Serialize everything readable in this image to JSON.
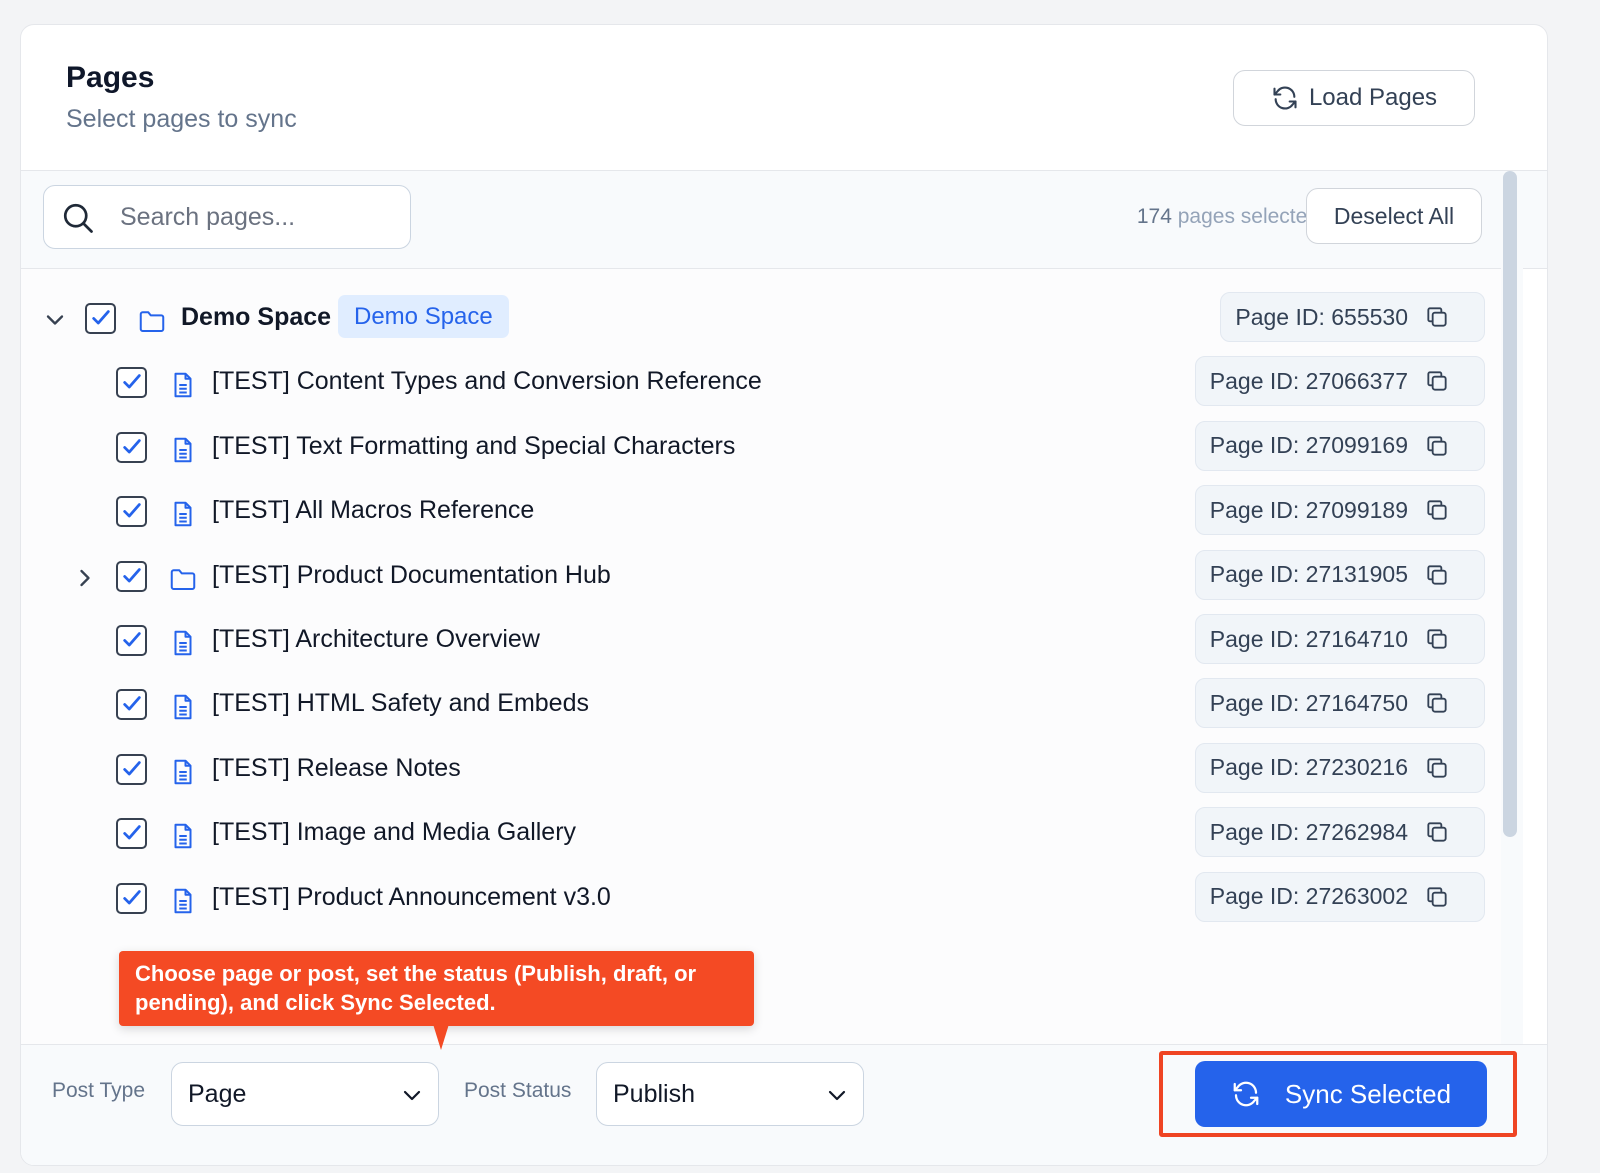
{
  "header": {
    "title": "Pages",
    "subtitle": "Select pages to sync",
    "load_button": "Load Pages"
  },
  "toolbar": {
    "search_placeholder": "Search pages...",
    "selected_count": "174",
    "selected_suffix": " pages selected",
    "deselect_button": "Deselect All"
  },
  "tree": {
    "space": {
      "label": "Demo Space",
      "badge": "Demo Space",
      "page_id": "Page ID: 655530",
      "checked": true,
      "expanded": true
    },
    "pages": [
      {
        "label": "[TEST] Content Types and Conversion Reference",
        "page_id": "Page ID: 27066377",
        "type": "page",
        "checked": true
      },
      {
        "label": "[TEST] Text Formatting and Special Characters",
        "page_id": "Page ID: 27099169",
        "type": "page",
        "checked": true
      },
      {
        "label": "[TEST] All Macros Reference",
        "page_id": "Page ID: 27099189",
        "type": "page",
        "checked": true
      },
      {
        "label": "[TEST] Product Documentation Hub",
        "page_id": "Page ID: 27131905",
        "type": "folder",
        "checked": true,
        "expandable": true
      },
      {
        "label": "[TEST] Architecture Overview",
        "page_id": "Page ID: 27164710",
        "type": "page",
        "checked": true
      },
      {
        "label": "[TEST] HTML Safety and Embeds",
        "page_id": "Page ID: 27164750",
        "type": "page",
        "checked": true
      },
      {
        "label": "[TEST] Release Notes",
        "page_id": "Page ID: 27230216",
        "type": "page",
        "checked": true
      },
      {
        "label": "[TEST] Image and Media Gallery",
        "page_id": "Page ID: 27262984",
        "type": "page",
        "checked": true
      },
      {
        "label": "[TEST] Product Announcement v3.0",
        "page_id": "Page ID: 27263002",
        "type": "page",
        "checked": true
      }
    ]
  },
  "tooltip": {
    "text": "Choose page or post, set the status (Publish, draft, or pending), and click Sync Selected."
  },
  "footer": {
    "post_type_label": "Post Type",
    "post_type_value": "Page",
    "post_status_label": "Post Status",
    "post_status_value": "Publish",
    "sync_button": "Sync Selected"
  },
  "colors": {
    "accent": "#2563eb",
    "badge_bg": "#e0edff",
    "highlight": "#ef4423",
    "tooltip_bg": "#f44a24"
  },
  "icons": {
    "load": "refresh-icon",
    "search": "search-icon",
    "copy": "copy-icon",
    "folder": "folder-icon",
    "page": "document-icon",
    "sync": "refresh-icon",
    "select": "chevron-down-icon"
  }
}
